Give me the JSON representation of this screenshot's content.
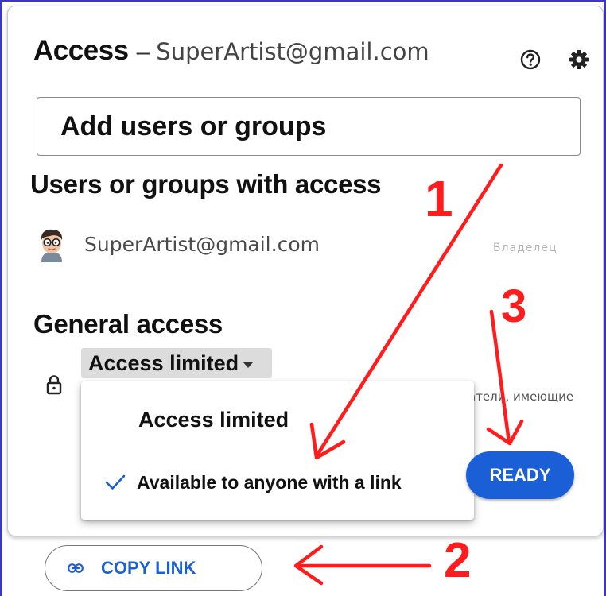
{
  "dialog": {
    "title": "Access",
    "title_dash": "–",
    "title_email": "SuperArtist@gmail.com",
    "help_icon": "help-circle-icon",
    "settings_icon": "gear-icon"
  },
  "add_users": {
    "placeholder": "Add users or groups"
  },
  "users_section": {
    "heading": "Users or groups with access",
    "users": [
      {
        "email": "SuperArtist@gmail.com",
        "role": "Владелец",
        "avatar": "cartoon-avatar-with-glasses"
      }
    ]
  },
  "general_access": {
    "heading": "General access",
    "selected": "Access limited",
    "lock_icon": "lock-icon",
    "behind_text": "атели, имеющие",
    "options": [
      {
        "label": "Access limited",
        "checked": false
      },
      {
        "label": "Available to anyone with a link",
        "checked": true
      }
    ]
  },
  "ready_button": {
    "label": "READY"
  },
  "copy_link": {
    "label": "COPY LINK",
    "icon": "link-icon"
  },
  "annotations": {
    "color": "#ff1c1c",
    "step1": "1",
    "step2": "2",
    "step3": "3"
  },
  "colors": {
    "accent": "#1a5fd6",
    "frame": "#3b35c9",
    "annotation": "#ff1c1c"
  }
}
